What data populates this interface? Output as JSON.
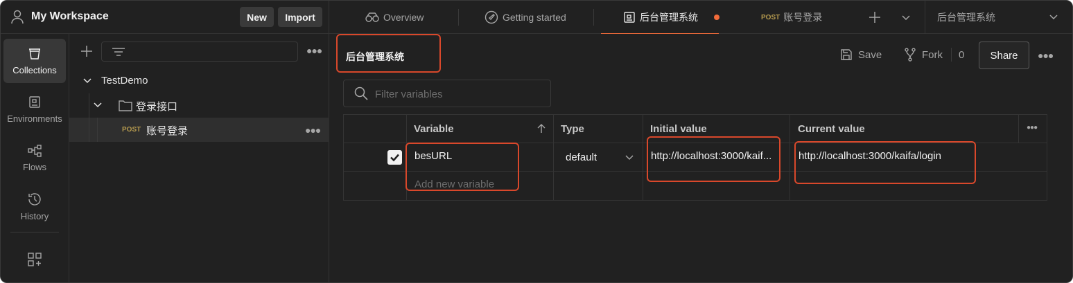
{
  "workspace": {
    "title": "My Workspace",
    "new_label": "New",
    "import_label": "Import"
  },
  "tabs": [
    {
      "label": "Overview"
    },
    {
      "label": "Getting started"
    },
    {
      "label": "后台管理系统"
    },
    {
      "method": "POST",
      "label": "账号登录"
    }
  ],
  "environment": {
    "selected": "后台管理系统"
  },
  "leftnav": [
    {
      "label": "Collections"
    },
    {
      "label": "Environments"
    },
    {
      "label": "Flows"
    },
    {
      "label": "History"
    }
  ],
  "tree": {
    "collection": "TestDemo",
    "folder": "登录接口",
    "request": {
      "method": "POST",
      "name": "账号登录"
    }
  },
  "main": {
    "title": "后台管理系统",
    "save_label": "Save",
    "fork_label": "Fork",
    "fork_count": "0",
    "share_label": "Share",
    "filter_placeholder": "Filter variables"
  },
  "table": {
    "headers": {
      "variable": "Variable",
      "type": "Type",
      "initial": "Initial value",
      "current": "Current value"
    },
    "rows": [
      {
        "enabled": true,
        "variable": "besURL",
        "type": "default",
        "initial": "http://localhost:3000/kaif...",
        "current": "http://localhost:3000/kaifa/login"
      }
    ],
    "add_placeholder": "Add new variable"
  },
  "colors": {
    "accent": "#f26b3a",
    "highlight": "#d9482b",
    "background": "#212121"
  }
}
